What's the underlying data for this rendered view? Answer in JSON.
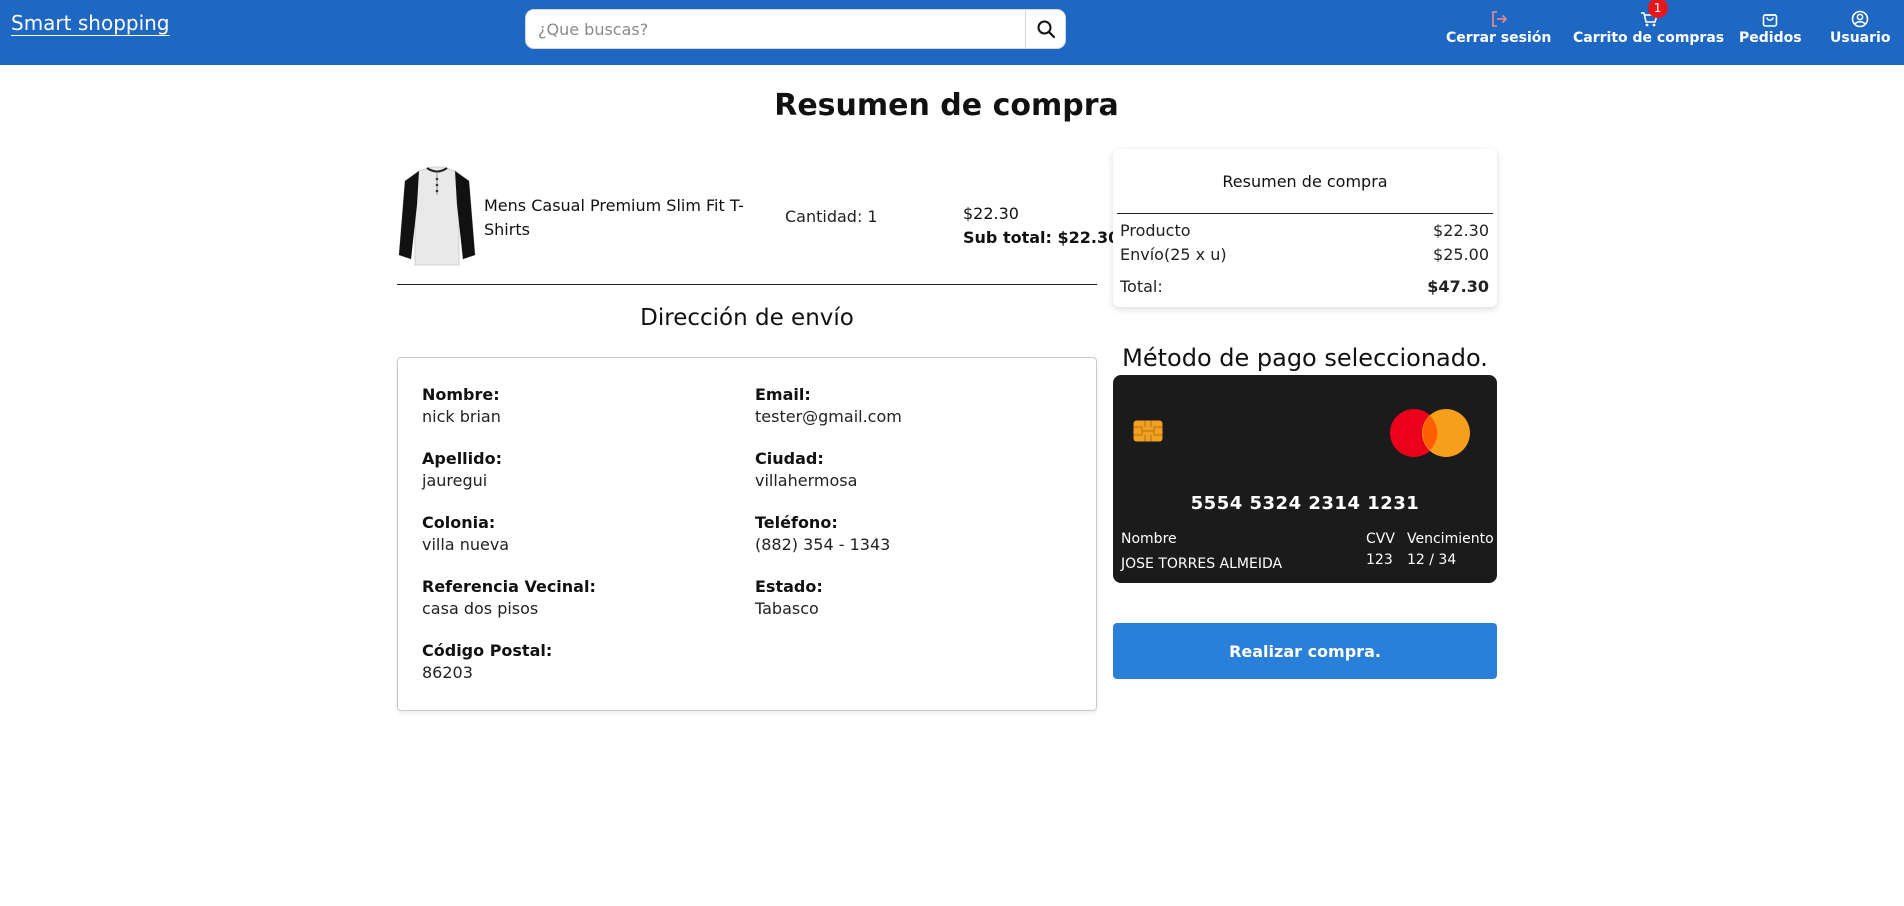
{
  "header": {
    "brand": "Smart shopping",
    "search": {
      "placeholder": "¿Que buscas?",
      "value": ""
    },
    "nav": {
      "logout_label": "Cerrar sesión",
      "cart_label": "Carrito de compras",
      "cart_count": "1",
      "orders_label": "Pedidos",
      "user_label": "Usuario"
    }
  },
  "page": {
    "title": "Resumen de compra"
  },
  "product": {
    "name": "Mens Casual Premium Slim Fit T-Shirts",
    "quantity": "Cantidad: 1",
    "price": "$22.30",
    "subtotal": "Sub total: $22.30"
  },
  "shipping": {
    "title": "Dirección de envío",
    "fields": {
      "nombre": {
        "label": "Nombre:",
        "value": "nick brian"
      },
      "email": {
        "label": "Email:",
        "value": "tester@gmail.com"
      },
      "apellido": {
        "label": "Apellido:",
        "value": "jauregui"
      },
      "ciudad": {
        "label": "Ciudad:",
        "value": "villahermosa"
      },
      "colonia": {
        "label": "Colonia:",
        "value": "villa nueva"
      },
      "telefono": {
        "label": "Teléfono:",
        "value": "(882) 354 - 1343"
      },
      "referencia": {
        "label": "Referencia Vecinal:",
        "value": "casa dos pisos"
      },
      "estado": {
        "label": "Estado:",
        "value": "Tabasco"
      },
      "cp": {
        "label": "Código Postal:",
        "value": "86203"
      }
    }
  },
  "summary": {
    "title": "Resumen de compra",
    "product_label": "Producto",
    "product_value": "$22.30",
    "shipping_label": "Envío(25 x u)",
    "shipping_value": "$25.00",
    "total_label": "Total:",
    "total_value": "$47.30"
  },
  "payment": {
    "title": "Método de pago seleccionado.",
    "card_number": "5554 5324 2314 1231",
    "name_label": "Nombre",
    "name_value": "JOSE TORRES ALMEIDA",
    "cvv_label": "CVV",
    "cvv_value": "123",
    "exp_label": "Vencimiento",
    "exp_value": "12 / 34"
  },
  "actions": {
    "buy_label": "Realizar compra."
  },
  "colors": {
    "header_bg": "#1e68c4",
    "button_bg": "#2a7fd9",
    "card_bg": "#1b1b1b",
    "badge": "#e5161d",
    "logout_icon": "#f08a8a"
  }
}
